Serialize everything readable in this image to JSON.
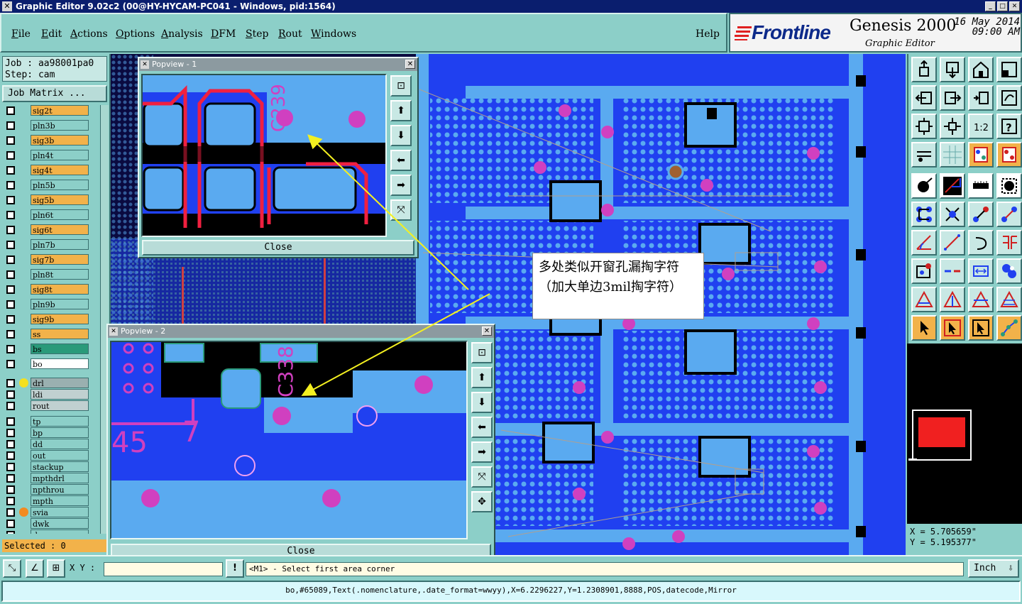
{
  "window": {
    "title": "Graphic Editor 9.02c2 (00@HY-HYCAM-PC041 - Windows, pid:1564)"
  },
  "menu": {
    "items": [
      {
        "first": "F",
        "rest": "ile"
      },
      {
        "first": "E",
        "rest": "dit"
      },
      {
        "first": "A",
        "rest": "ctions"
      },
      {
        "first": "O",
        "rest": "ptions"
      },
      {
        "first": "A",
        "rest": "nalysis"
      },
      {
        "first": "D",
        "rest": "FM"
      },
      {
        "first": "S",
        "rest": "tep"
      },
      {
        "first": "R",
        "rest": "out"
      },
      {
        "first": "W",
        "rest": "indows"
      }
    ],
    "help": "Help"
  },
  "brand": {
    "logo": "Frontline",
    "product": "Genesis 2000",
    "subtitle": "Graphic Editor",
    "date": "16 May 2014",
    "time": "09:00 AM"
  },
  "job": {
    "job_line": "Job : aa98001pa0",
    "step_line": "Step: cam",
    "matrix_button": "Job Matrix ..."
  },
  "layers": [
    {
      "name": "sig2t",
      "color": "#f2b24a"
    },
    {
      "name": "pln3b",
      "color": "#8ccfc8"
    },
    {
      "name": "sig3b",
      "color": "#f2b24a"
    },
    {
      "name": "pln4t",
      "color": "#8ccfc8"
    },
    {
      "name": "sig4t",
      "color": "#f2b24a"
    },
    {
      "name": "pln5b",
      "color": "#8ccfc8"
    },
    {
      "name": "sig5b",
      "color": "#f2b24a"
    },
    {
      "name": "pln6t",
      "color": "#8ccfc8"
    },
    {
      "name": "sig6t",
      "color": "#f2b24a"
    },
    {
      "name": "pln7b",
      "color": "#8ccfc8"
    },
    {
      "name": "sig7b",
      "color": "#f2b24a"
    },
    {
      "name": "pln8t",
      "color": "#8ccfc8"
    },
    {
      "name": "sig8t",
      "color": "#f2b24a"
    },
    {
      "name": "pln9b",
      "color": "#8ccfc8"
    },
    {
      "name": "sig9b",
      "color": "#f2b24a"
    },
    {
      "name": "ss",
      "color": "#f2b24a"
    },
    {
      "name": "bs",
      "color": "#2a9a7a"
    },
    {
      "name": "bo",
      "color": "#ffffff"
    },
    {
      "name": "drl",
      "color": "#9ab0b0",
      "dot": "#f4e020"
    },
    {
      "name": "ldi",
      "color": "#c0d0d0"
    },
    {
      "name": "rout",
      "color": "#c0d0d0"
    },
    {
      "name": "tp",
      "color": "#8ccfc8"
    },
    {
      "name": "bp",
      "color": "#8ccfc8"
    },
    {
      "name": "dd",
      "color": "#8ccfc8"
    },
    {
      "name": "out",
      "color": "#8ccfc8"
    },
    {
      "name": "stackup",
      "color": "#8ccfc8"
    },
    {
      "name": "mpthdrl",
      "color": "#8ccfc8"
    },
    {
      "name": "npthrou",
      "color": "#8ccfc8"
    },
    {
      "name": "mpth",
      "color": "#8ccfc8"
    },
    {
      "name": "svia",
      "color": "#8ccfc8",
      "dot": "#f28a20"
    },
    {
      "name": "dwk",
      "color": "#8ccfc8"
    },
    {
      "name": "d",
      "color": "#8ccfc8"
    }
  ],
  "selection": {
    "label": "Selected : 0"
  },
  "popview1": {
    "title": "Popview - 1",
    "close": "Close",
    "silk_text": "C239"
  },
  "popview2": {
    "title": "Popview - 2",
    "close": "Close",
    "silk_text": "C338",
    "pad_text_a": "7",
    "pad_text_b": "45"
  },
  "callout": {
    "text": "多处类似开窗孔漏掏字符（加大单边3mil掏字符）"
  },
  "coords": {
    "x_line": "X =  5.705659\"",
    "y_line": "Y =  5.195377\""
  },
  "bottom": {
    "xy_label": "X Y :",
    "xy_value": "",
    "message": "<M1> - Select first area corner",
    "unit": "Inch",
    "status": "bo,#65089,Text(.nomenclature,.date_format=wwyy),X=6.2296227,Y=1.2308901,8888,POS,datecode,Mirror"
  },
  "colors": {
    "board_blue": "#2040f0",
    "copper_light": "#5aaaf0",
    "drill_pink": "#d040c0",
    "trace_red": "#f02040",
    "panel": "#8ccfc8",
    "accent_orange": "#f2b24a"
  }
}
